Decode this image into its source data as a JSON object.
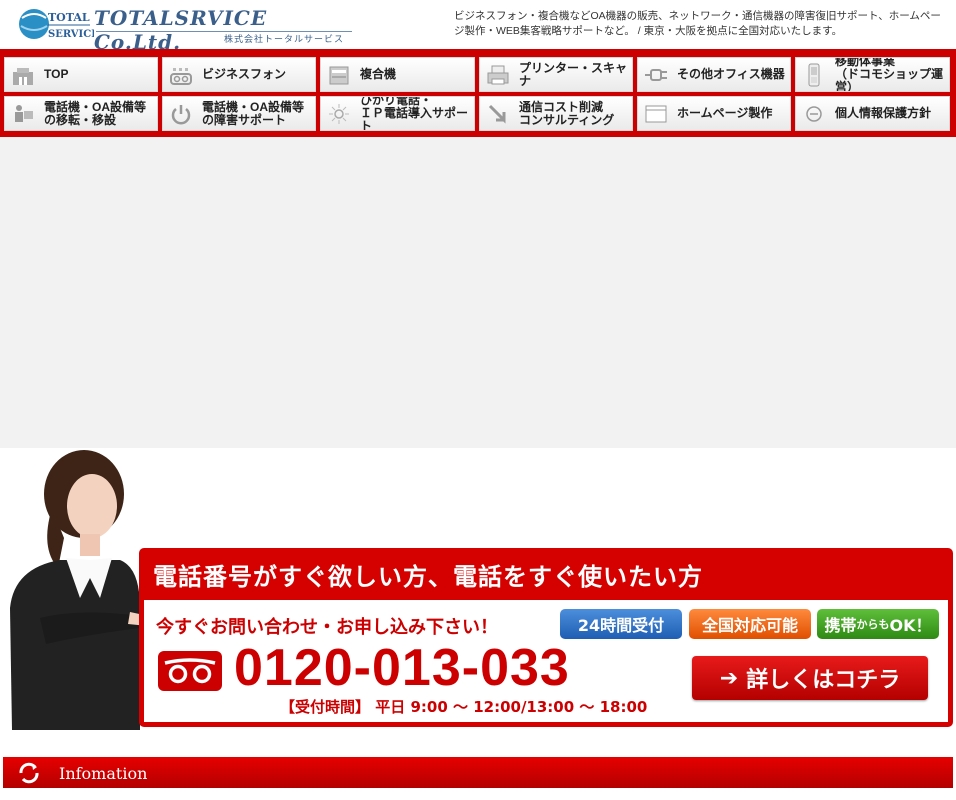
{
  "header": {
    "logo_mark_top": "TOTAL",
    "logo_mark_bottom": "SERVICE",
    "logo_text": "TOTALSRVICE Co.Ltd.",
    "logo_sub": "株式会社トータルサービス",
    "description": "ビジネスフォン・複合機などOA機器の販売、ネットワーク・通信機器の障害復旧サポート、ホームページ製作・WEB集客戦略サポートなど。 / 東京・大阪を拠点に全国対応いたします。"
  },
  "nav": {
    "items": [
      {
        "label": "TOP",
        "icon": "home-icon"
      },
      {
        "label": "ビジネスフォン",
        "icon": "business-phone-icon"
      },
      {
        "label": "複合機",
        "icon": "copier-icon"
      },
      {
        "label": "プリンター・スキャナ",
        "icon": "printer-icon"
      },
      {
        "label": "その他オフィス機器",
        "icon": "plug-icon"
      },
      {
        "label": "移動体事業\n（ドコモショップ運営）",
        "icon": "mobile-phone-icon"
      },
      {
        "label": "電話機・OA設備等\nの移転・移設",
        "icon": "mover-icon"
      },
      {
        "label": "電話機・OA設備等\nの障害サポート",
        "icon": "power-icon"
      },
      {
        "label": "ひかり電話・\n ＩＰ電話導入サポート",
        "icon": "light-icon"
      },
      {
        "label": "通信コスト削減\nコンサルティング",
        "icon": "down-arrow-icon"
      },
      {
        "label": "ホームページ製作",
        "icon": "browser-icon"
      },
      {
        "label": "個人情報保護方針",
        "icon": "minus-circle-icon"
      }
    ]
  },
  "contact": {
    "headline": "電話番号がすぐ欲しい方、電話をすぐ使いたい方",
    "subheadline": "今すぐお問い合わせ・お申し込み下さい！",
    "badge_24h": "24時間受付",
    "badge_nationwide": "全国対応可能",
    "badge_mobile_main": "携帯",
    "badge_mobile_small": "からも",
    "badge_mobile_end": "OK！",
    "phone": "0120-013-033",
    "hours": "【受付時間】 平日 9:00 ～ 12:00/13:00 ～ 18:00",
    "more_button": "詳しくはコチラ",
    "colors": {
      "red": "#cc0000",
      "blue": "#1f5eb3",
      "orange": "#e04f00",
      "green": "#2e8a14"
    }
  },
  "info": {
    "title": "Infomation"
  }
}
